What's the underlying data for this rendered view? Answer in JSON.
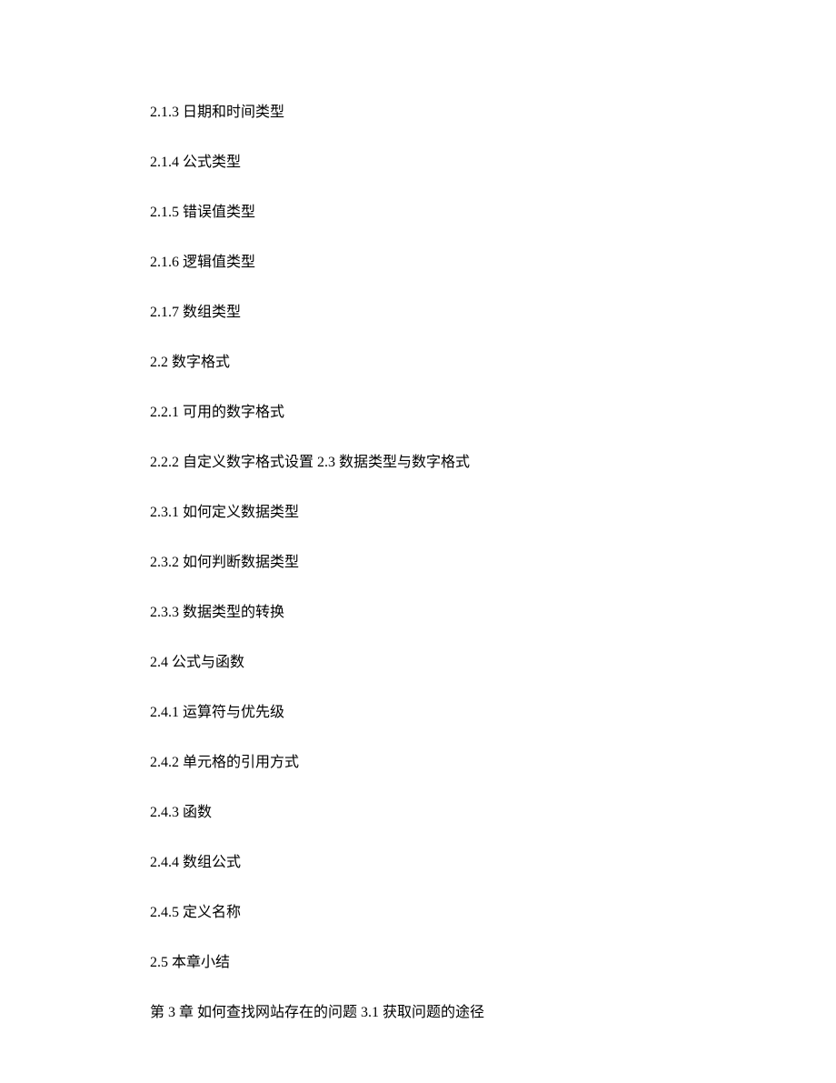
{
  "toc": {
    "entries": [
      "2.1.3 日期和时间类型",
      "2.1.4 公式类型",
      "2.1.5 错误值类型",
      "2.1.6 逻辑值类型",
      "2.1.7 数组类型",
      "2.2 数字格式",
      "2.2.1 可用的数字格式",
      "2.2.2 自定义数字格式设置 2.3 数据类型与数字格式",
      "2.3.1 如何定义数据类型",
      "2.3.2 如何判断数据类型",
      "2.3.3 数据类型的转换",
      "2.4 公式与函数",
      "2.4.1 运算符与优先级",
      "2.4.2 单元格的引用方式",
      "2.4.3 函数",
      "2.4.4 数组公式",
      "2.4.5 定义名称",
      "2.5 本章小结",
      "第 3 章 如何查找网站存在的问题 3.1 获取问题的途径"
    ]
  }
}
